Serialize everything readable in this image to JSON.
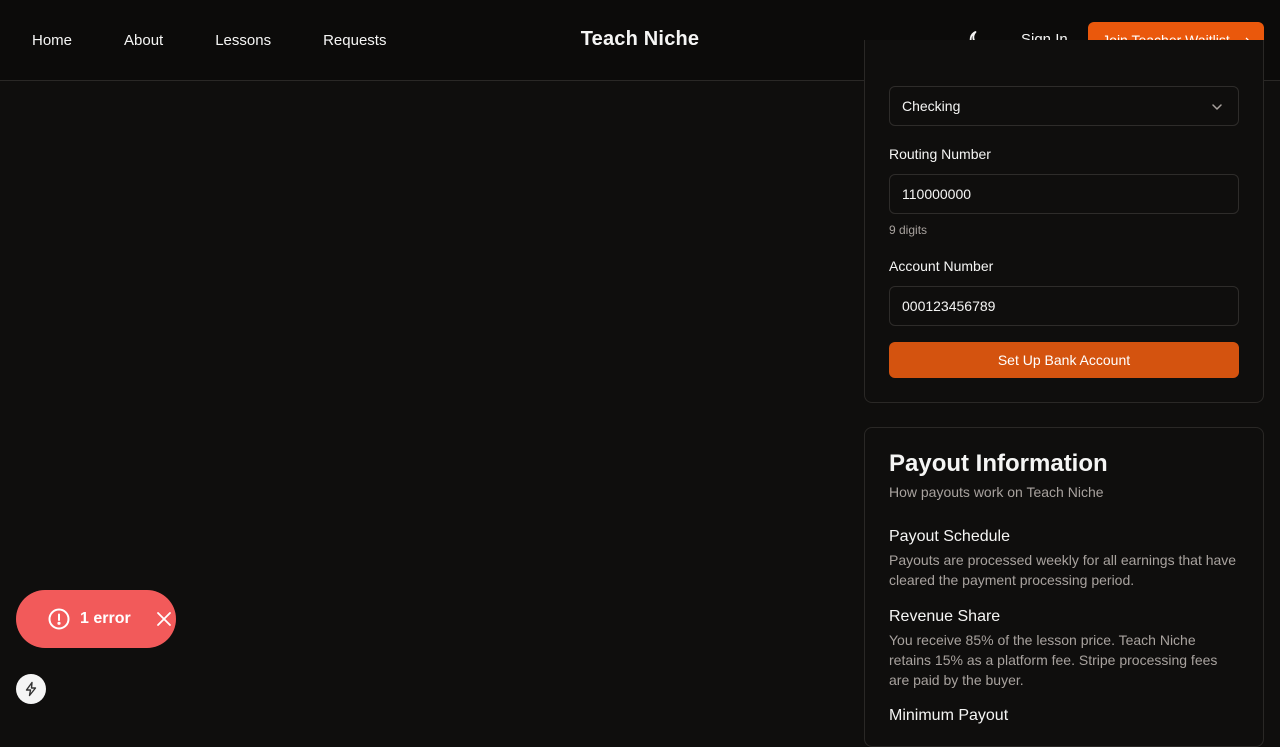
{
  "header": {
    "nav": [
      {
        "label": "Home"
      },
      {
        "label": "About"
      },
      {
        "label": "Lessons"
      },
      {
        "label": "Requests"
      }
    ],
    "brand": "Teach Niche",
    "theme_icon": "moon-icon",
    "sign_in": "Sign In",
    "cta_label": "Join Teacher Waitlist",
    "cta_arrow": "⟶"
  },
  "bank_form": {
    "account_type_value": "Checking",
    "routing_label": "Routing Number",
    "routing_value": "110000000",
    "routing_hint": "9 digits",
    "account_label": "Account Number",
    "account_value": "000123456789",
    "submit_label": "Set Up Bank Account"
  },
  "payout_info": {
    "title": "Payout Information",
    "subtitle": "How payouts work on Teach Niche",
    "sections": [
      {
        "heading": "Payout Schedule",
        "body": "Payouts are processed weekly for all earnings that have cleared the payment processing period."
      },
      {
        "heading": "Revenue Share",
        "body": "You receive 85% of the lesson price. Teach Niche retains 15% as a platform fee. Stripe processing fees are paid by the buyer."
      },
      {
        "heading": "Minimum Payout",
        "body": ""
      }
    ]
  },
  "dev_overlay": {
    "error_label": "1 error",
    "error_color": "#f25a5a"
  },
  "colors": {
    "accent": "#ea580c",
    "background": "#0f0e0d"
  }
}
